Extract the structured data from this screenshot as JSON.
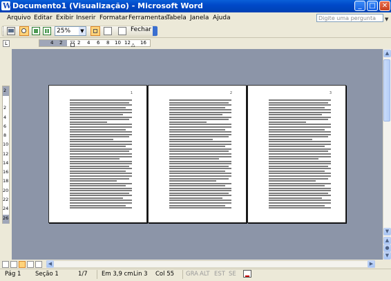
{
  "window": {
    "title": "Documento1 (Visualização) - Microsoft Word",
    "app_icon_letter": "W"
  },
  "window_buttons": {
    "minimize": "_",
    "maximize": "□",
    "close": "✕"
  },
  "menu": [
    "Arquivo",
    "Editar",
    "Exibir",
    "Inserir",
    "Formatar",
    "Ferramentas",
    "Tabela",
    "Janela",
    "Ajuda"
  ],
  "ask_box": {
    "placeholder": "Digite uma pergunta"
  },
  "toolbar": {
    "zoom": "25%",
    "close_label": "Fechar"
  },
  "ruler": {
    "ticks": [
      "4",
      "2",
      "2",
      "4",
      "6",
      "8",
      "10",
      "12",
      "16"
    ]
  },
  "vruler": {
    "ticks": [
      "2",
      "2",
      "4",
      "6",
      "8",
      "10",
      "12",
      "14",
      "16",
      "18",
      "20",
      "22",
      "24",
      "26"
    ]
  },
  "pages": [
    {
      "number": "1"
    },
    {
      "number": "2"
    },
    {
      "number": "3"
    }
  ],
  "status": {
    "page": "Pág 1",
    "section": "Seção 1",
    "pages": "1/7",
    "position": "Em 3,9 cm",
    "line": "Lin 3",
    "col": "Col 55",
    "rec": "GRA",
    "trk": "ALT",
    "ext": "EST",
    "ovr": "SE"
  },
  "colors": {
    "titlebar": "#0A5FD8",
    "workspace": "#8C95A8",
    "chrome": "#ECE9D8"
  }
}
